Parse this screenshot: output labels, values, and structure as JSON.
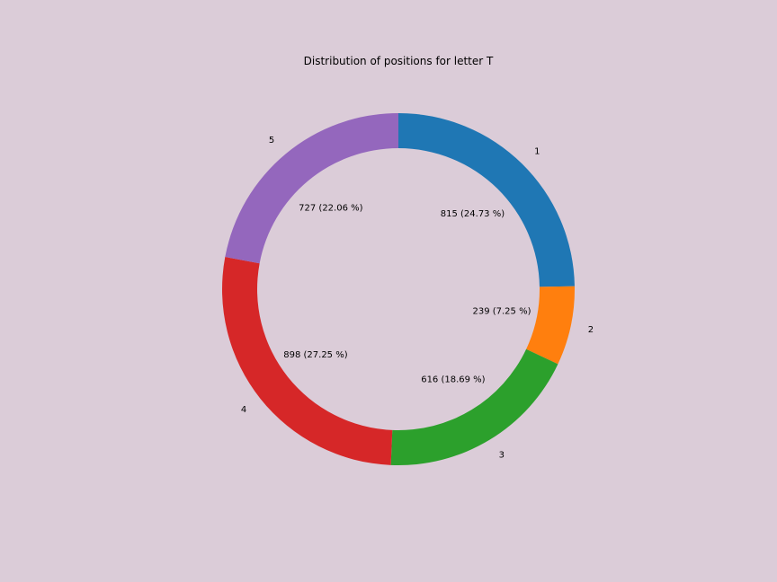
{
  "background_color": "#dbccd8",
  "chart_data": {
    "type": "pie",
    "style": "donut",
    "title": "Distribution of positions for letter T",
    "start_angle_deg": 90,
    "direction": "clockwise",
    "categories": [
      "1",
      "2",
      "3",
      "4",
      "5"
    ],
    "values": [
      815,
      239,
      616,
      898,
      727
    ],
    "value_labels": [
      "815 (24.73 %)",
      "239 (7.25 %)",
      "616 (18.69 %)",
      "898 (27.25 %)",
      "727 (22.06 %)"
    ],
    "colors": [
      "#1f77b4",
      "#ff7f0e",
      "#2ca02c",
      "#d62728",
      "#9467bd"
    ]
  }
}
